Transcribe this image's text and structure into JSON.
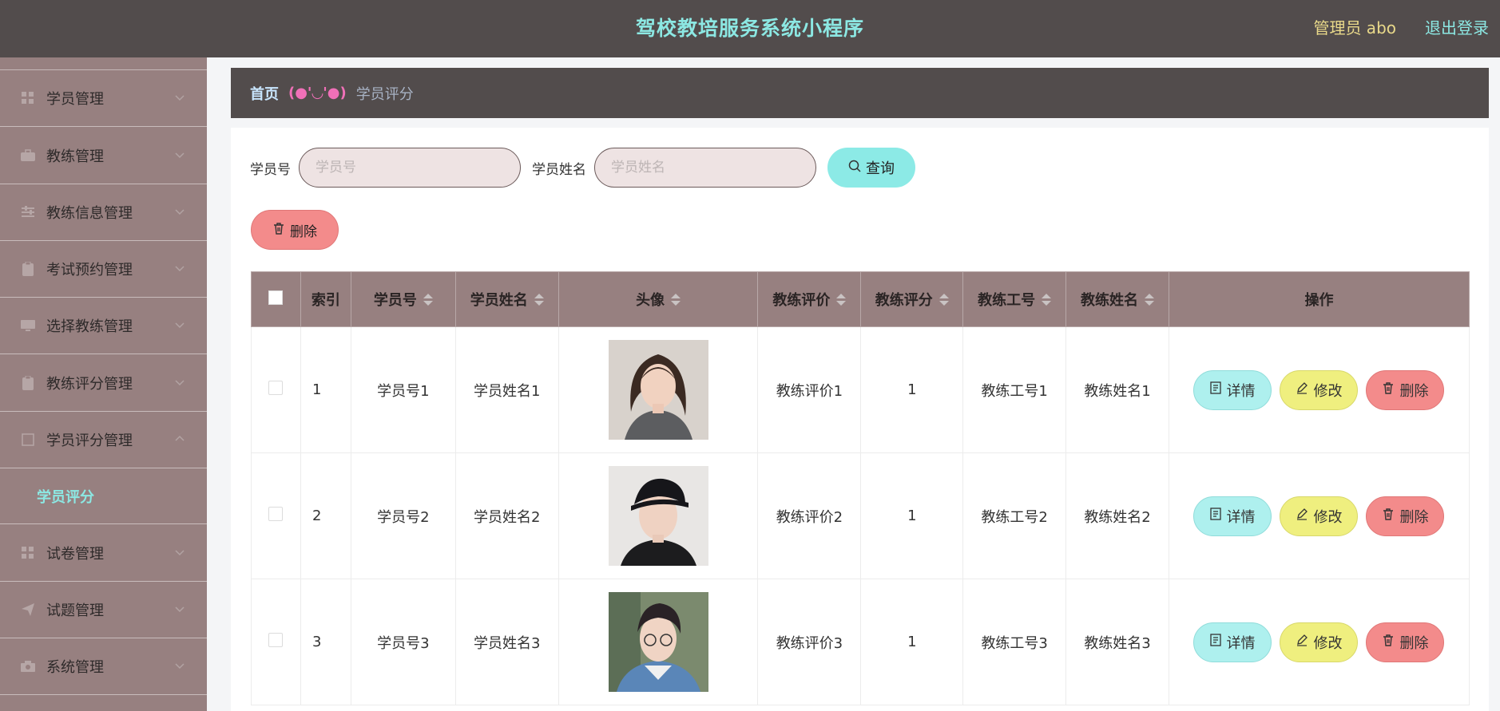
{
  "header": {
    "title": "驾校教培服务系统小程序",
    "admin_label": "管理员 abo",
    "logout_label": "退出登录"
  },
  "sidebar": {
    "items": [
      {
        "label": "学员管理",
        "icon": "grid-icon"
      },
      {
        "label": "教练管理",
        "icon": "briefcase-icon"
      },
      {
        "label": "教练信息管理",
        "icon": "sliders-icon"
      },
      {
        "label": "考试预约管理",
        "icon": "clipboard-icon"
      },
      {
        "label": "选择教练管理",
        "icon": "monitor-icon"
      },
      {
        "label": "教练评分管理",
        "icon": "clipboard-icon"
      },
      {
        "label": "学员评分管理",
        "icon": "square-icon",
        "expanded": true
      },
      {
        "label": "试卷管理",
        "icon": "grid-icon"
      },
      {
        "label": "试题管理",
        "icon": "send-icon"
      },
      {
        "label": "系统管理",
        "icon": "camera-icon"
      }
    ],
    "submenu_active": "学员评分"
  },
  "breadcrumb": {
    "home": "首页",
    "separator": "(●'◡'●)",
    "current": "学员评分"
  },
  "search": {
    "student_no_label": "学员号",
    "student_no_placeholder": "学员号",
    "student_name_label": "学员姓名",
    "student_name_placeholder": "学员姓名",
    "query_label": "查询"
  },
  "toolbar": {
    "delete_label": "删除"
  },
  "table": {
    "headers": {
      "index": "索引",
      "student_no": "学员号",
      "student_name": "学员姓名",
      "avatar": "头像",
      "coach_review": "教练评价",
      "coach_score": "教练评分",
      "coach_no": "教练工号",
      "coach_name": "教练姓名",
      "actions": "操作"
    },
    "rows": [
      {
        "index": "1",
        "student_no": "学员号1",
        "student_name": "学员姓名1",
        "coach_review": "教练评价1",
        "coach_score": "1",
        "coach_no": "教练工号1",
        "coach_name": "教练姓名1"
      },
      {
        "index": "2",
        "student_no": "学员号2",
        "student_name": "学员姓名2",
        "coach_review": "教练评价2",
        "coach_score": "1",
        "coach_no": "教练工号2",
        "coach_name": "教练姓名2"
      },
      {
        "index": "3",
        "student_no": "学员号3",
        "student_name": "学员姓名3",
        "coach_review": "教练评价3",
        "coach_score": "1",
        "coach_no": "教练工号3",
        "coach_name": "教练姓名3"
      }
    ],
    "actions": {
      "detail": "详情",
      "edit": "修改",
      "delete": "删除"
    }
  },
  "colors": {
    "header_bg": "#524c4c",
    "sidebar_bg": "#978080",
    "accent_cyan": "#8ce8e3",
    "admin_gold": "#e9d98a",
    "delete_red": "#f38b8b",
    "edit_yellow": "#efef7f"
  }
}
